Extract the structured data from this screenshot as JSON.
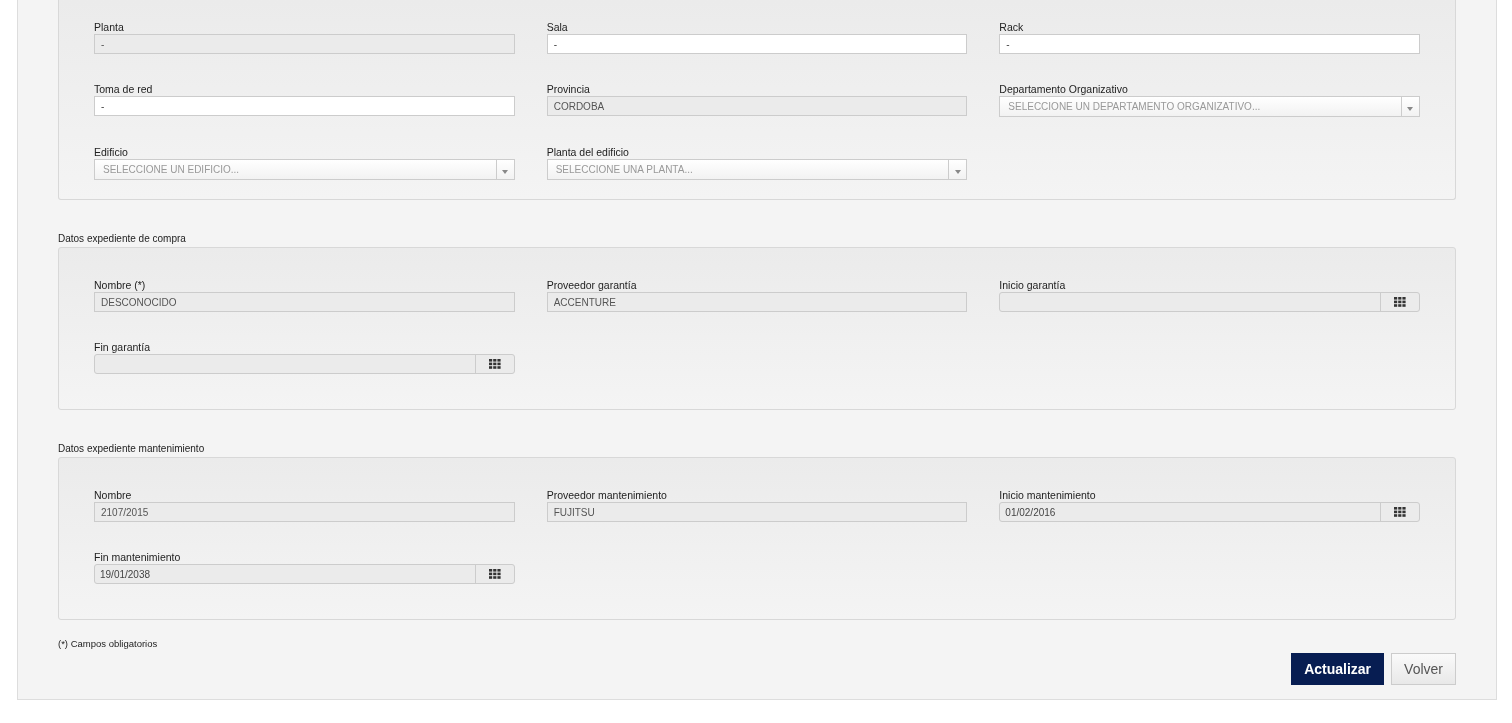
{
  "sections": [
    {
      "fields": [
        {
          "label": "Planta",
          "kind": "text",
          "value": "-",
          "disabled": true
        },
        {
          "label": "Sala",
          "kind": "text",
          "value": "-",
          "disabled": false
        },
        {
          "label": "Rack",
          "kind": "text",
          "value": "-",
          "disabled": false
        },
        {
          "label": "Toma de red",
          "kind": "text",
          "value": "-",
          "disabled": false
        },
        {
          "label": "Provincia",
          "kind": "text",
          "value": "CORDOBA",
          "disabled": true
        },
        {
          "label": "Departamento Organizativo",
          "kind": "select",
          "placeholder": "SELECCIONE UN DEPARTAMENTO ORGANIZATIVO...",
          "disabled": false
        },
        {
          "label": "Edificio",
          "kind": "select",
          "placeholder": "SELECCIONE UN EDIFICIO...",
          "disabled": false
        },
        {
          "label": "Planta del edificio",
          "kind": "select",
          "placeholder": "SELECCIONE UNA PLANTA...",
          "disabled": false
        }
      ]
    },
    {
      "title": "Datos expediente de compra",
      "fields": [
        {
          "label": "Nombre (*)",
          "kind": "text",
          "value": "DESCONOCIDO",
          "disabled": true
        },
        {
          "label": "Proveedor garantía",
          "kind": "text",
          "value": "ACCENTURE",
          "disabled": true
        },
        {
          "label": "Inicio garantía",
          "kind": "date",
          "disabled": true
        },
        {
          "label": "Fin garantía",
          "kind": "date",
          "disabled": true
        }
      ]
    },
    {
      "title": "Datos expediente mantenimiento",
      "fields": [
        {
          "label": "Nombre",
          "kind": "text",
          "value": "2107/2015",
          "disabled": true
        },
        {
          "label": "Proveedor mantenimiento",
          "kind": "text",
          "value": "FUJITSU",
          "disabled": true
        },
        {
          "label": "Inicio mantenimiento",
          "kind": "date",
          "value": "01/02/2016",
          "disabled": true
        },
        {
          "label": "Fin mantenimiento",
          "kind": "date",
          "value": "19/01/2038",
          "disabled": true
        }
      ]
    }
  ],
  "footnote": "(*) Campos obligatorios",
  "buttons": [
    {
      "label": "Actualizar",
      "kind": "primary"
    },
    {
      "label": "Volver",
      "kind": "secondary"
    }
  ]
}
